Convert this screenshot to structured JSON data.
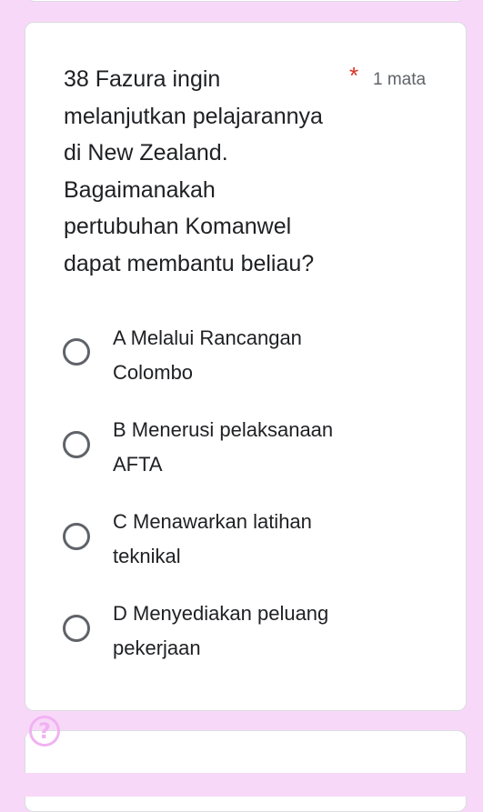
{
  "question": {
    "title": "38 Fazura ingin\nmelanjutkan pelajarannya\ndi New Zealand.\nBagaimanakah\npertubuhan Komanwel\ndapat membantu beliau?",
    "required_marker": "*",
    "points": "1 mata"
  },
  "options": [
    {
      "label": "A Melalui Rancangan\nColombo",
      "selected": false
    },
    {
      "label": "B Menerusi pelaksanaan\nAFTA",
      "selected": false
    },
    {
      "label": "C Menawarkan latihan\nteknikal",
      "selected": false
    },
    {
      "label": "D Menyediakan peluang\npekerjaan",
      "selected": false
    }
  ],
  "help": {
    "icon": "question-mark-icon",
    "glyph": "?"
  },
  "colors": {
    "background": "#f8d8f8",
    "card": "#ffffff",
    "required": "#d93025",
    "radio_border": "#5f6368"
  }
}
